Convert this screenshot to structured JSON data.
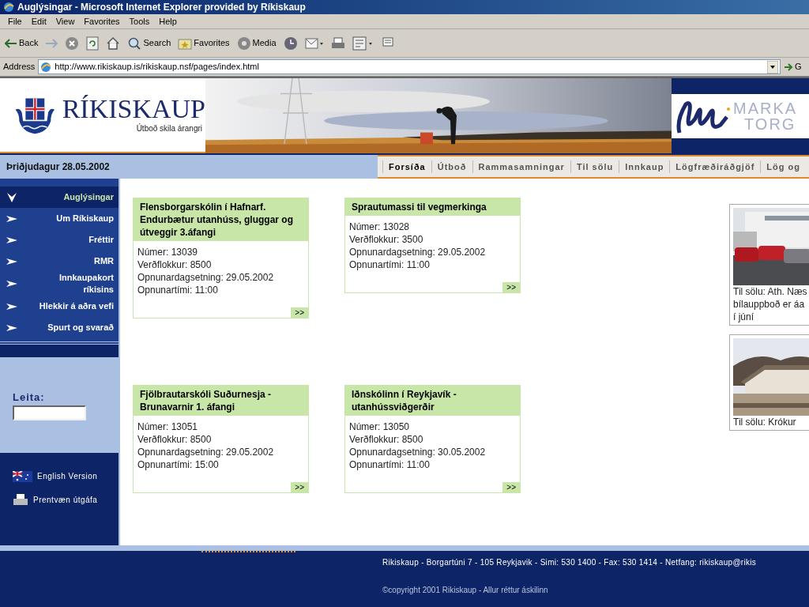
{
  "browser": {
    "title": "Auglýsingar - Microsoft Internet Explorer provided by Ríkiskaup",
    "menu": [
      "File",
      "Edit",
      "View",
      "Favorites",
      "Tools",
      "Help"
    ],
    "toolbar": [
      {
        "kind": "back",
        "label": "Back"
      },
      {
        "kind": "forward"
      },
      {
        "kind": "stop"
      },
      {
        "kind": "refresh"
      },
      {
        "kind": "home"
      },
      {
        "kind": "search",
        "label": "Search"
      },
      {
        "kind": "favorites",
        "label": "Favorites"
      },
      {
        "kind": "media",
        "label": "Media"
      },
      {
        "kind": "history"
      },
      {
        "kind": "mail"
      },
      {
        "kind": "print"
      },
      {
        "kind": "edit"
      },
      {
        "kind": "discuss"
      }
    ],
    "address_label": "Address",
    "url": "http://www.rikiskaup.is/rikiskaup.nsf/pages/index.html",
    "go_label": "G"
  },
  "header": {
    "logo_name": "RÍKISKAUP",
    "tagline": "Útboð skila árangri",
    "partner_logo": [
      "MARKA",
      "TORG"
    ]
  },
  "date": "Þriðjudagur 28.05.2002",
  "nav_tabs": [
    {
      "label": "Forsíða",
      "selected": true
    },
    {
      "label": "Útboð",
      "selected": false
    },
    {
      "label": "Rammasamningar",
      "selected": false
    },
    {
      "label": "Til sölu",
      "selected": false
    },
    {
      "label": "Innkaup",
      "selected": false
    },
    {
      "label": "Lögfræðiráðgjöf",
      "selected": false
    },
    {
      "label": "Lög og",
      "selected": false
    }
  ],
  "sidebar": {
    "items": [
      {
        "label": "Auglýsingar",
        "selected": true
      },
      {
        "label": "Um Ríkiskaup",
        "selected": false
      },
      {
        "label": "Fréttir",
        "selected": false
      },
      {
        "label": "RMR",
        "selected": false
      },
      {
        "label": "Innkaupakort ríkisins",
        "selected": false
      },
      {
        "label": "Hlekkir á aðra vefi",
        "selected": false
      },
      {
        "label": "Spurt og svarað",
        "selected": false
      }
    ],
    "search_label": "Leita:",
    "links": [
      {
        "kind": "flag",
        "label": "English Version"
      },
      {
        "kind": "printer",
        "label": "Prentvæn útgáfa"
      }
    ]
  },
  "notices": [
    {
      "title": "Flensborgarskólin í Hafnarf. Endurbætur utanhúss, gluggar og útveggir 3.áfangi",
      "lines": [
        "Númer: 13039",
        "Verðflokkur: 8500",
        "Opnunardagsetning: 29.05.2002",
        "Opnunartími: 11:00"
      ],
      "more": ">>"
    },
    {
      "title": "Sprautumassi til vegmerkinga",
      "lines": [
        "Númer: 13028",
        "Verðflokkur: 3500",
        "Opnunardagsetning: 29.05.2002",
        "Opnunartími: 11:00"
      ],
      "more": ">>"
    },
    {
      "title": "Fjölbrautarskóli Suðurnesja - Brunavarnir 1. áfangi",
      "lines": [
        "Númer: 13051",
        "Verðflokkur: 8500",
        "Opnunardagsetning: 29.05.2002",
        "Opnunartími: 15:00"
      ],
      "more": ">>"
    },
    {
      "title": "Iðnskólinn í Reykjavík - utanhússviðgerðir",
      "lines": [
        "Númer: 13050",
        "Verðflokkur: 8500",
        "Opnunardagsetning: 30.05.2002",
        "Opnunartími: 11:00"
      ],
      "more": ">>"
    }
  ],
  "for_sale": [
    {
      "kind": "cars",
      "caption_lines": [
        "Til sölu: Ath. Næs",
        "bílauppboð er áa",
        "í júní"
      ]
    },
    {
      "kind": "house",
      "caption_lines": [
        "Til sölu: Krókur"
      ]
    }
  ],
  "footer": {
    "address": "Rikiskaup - Borgartúni 7 - 105 Reykjavik - Simi: 530 1400 - Fax: 530 1414 - Netfang: rikiskaup@rikis",
    "copyright": "©copyright 2001 Rikiskaup -  Allur réttur áskilinn"
  }
}
